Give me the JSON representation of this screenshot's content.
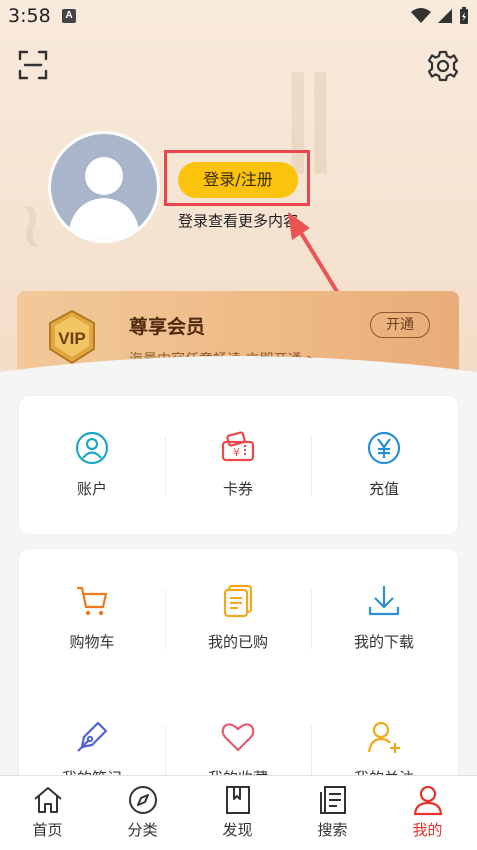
{
  "status_bar": {
    "time": "3:58",
    "notification_badge": "A"
  },
  "header": {
    "scan_icon": "scan-icon",
    "settings_icon": "gear-icon"
  },
  "profile": {
    "login_button": "登录/注册",
    "login_hint": "登录查看更多内容"
  },
  "vip": {
    "badge": "VIP",
    "title": "尊享会员",
    "subtitle": "海量内容任意畅读 立即开通 >",
    "open_button": "开通"
  },
  "quick_actions": [
    {
      "label": "账户",
      "icon": "account-icon"
    },
    {
      "label": "卡券",
      "icon": "coupon-icon"
    },
    {
      "label": "充值",
      "icon": "recharge-icon"
    }
  ],
  "services": [
    {
      "label": "购物车",
      "icon": "cart-icon"
    },
    {
      "label": "我的已购",
      "icon": "purchased-icon"
    },
    {
      "label": "我的下载",
      "icon": "download-icon"
    },
    {
      "label": "我的笔记",
      "icon": "note-icon"
    },
    {
      "label": "我的收藏",
      "icon": "heart-icon"
    },
    {
      "label": "我的关注",
      "icon": "follow-icon"
    }
  ],
  "tabbar": [
    {
      "label": "首页",
      "icon": "home-icon"
    },
    {
      "label": "分类",
      "icon": "compass-icon"
    },
    {
      "label": "发现",
      "icon": "book-icon"
    },
    {
      "label": "搜索",
      "icon": "search-doc-icon"
    },
    {
      "label": "我的",
      "icon": "user-icon",
      "active": true
    }
  ],
  "colors": {
    "accent": "#e8332c",
    "login_button": "#fbc30b",
    "highlight": "#e8474e"
  }
}
